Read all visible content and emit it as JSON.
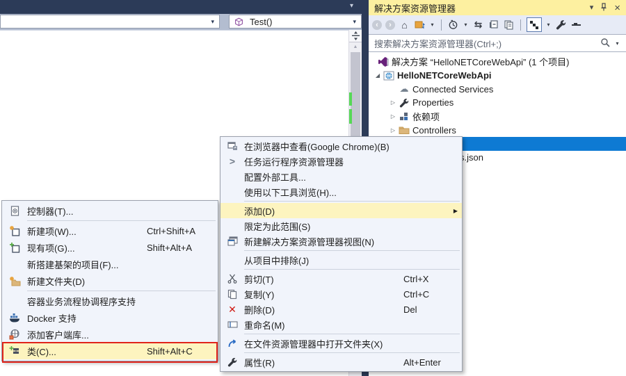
{
  "icons": {
    "dropdown": "▾",
    "up_arrow": "▲",
    "back": "‹",
    "forward": "›",
    "home": "⌂",
    "task_runner": ">",
    "refresh": "⇆",
    "cloud": "☁",
    "close": "×",
    "submenu_arrow": "▶",
    "expander_collapsed": "▷",
    "expander_expanded": "◢",
    "delete_x": "✕"
  },
  "colors": {
    "accent_selection": "#0e7ad3",
    "menu_highlight": "#fdf4bf",
    "tool_window_active_title": "#fdf0a0",
    "attention_border_red": "#e0241b",
    "top_bar_navy": "#2c3b58",
    "change_indicator_green": "#57d957"
  },
  "editor": {
    "type_dropdown_value": "",
    "member_dropdown_value": "Test()"
  },
  "solution_explorer": {
    "title": "解决方案资源管理器",
    "window_buttons": [
      "window-position",
      "pin",
      "close"
    ],
    "toolbar_icons": [
      "back",
      "forward",
      "home",
      "switch-views",
      "pending-changes-filter",
      "refresh",
      "collapse-all",
      "preview-selected-items",
      "sync-with-active-document",
      "properties",
      "collapse"
    ],
    "search_placeholder": "搜索解决方案资源管理器(Ctrl+;)",
    "tree": {
      "solution_label": "解决方案 “HelloNETCoreWebApi” (1 个项目)",
      "project_label": "HelloNETCoreWebApi",
      "items": [
        "Connected Services",
        "Properties",
        "依赖项",
        "Controllers"
      ],
      "selected_row_label": "",
      "partial_file_label": "s.json"
    }
  },
  "context_menu": {
    "items": [
      {
        "label": "在浏览器中查看(Google Chrome)(B)",
        "shortcut": ""
      },
      {
        "label": "任务运行程序资源管理器",
        "shortcut": ""
      },
      {
        "label": "配置外部工具...",
        "shortcut": ""
      },
      {
        "label": "使用以下工具浏览(H)...",
        "shortcut": ""
      },
      {
        "label": "添加(D)",
        "shortcut": "",
        "highlighted": true,
        "has_submenu": true
      },
      {
        "label": "限定为此范围(S)",
        "shortcut": ""
      },
      {
        "label": "新建解决方案资源管理器视图(N)",
        "shortcut": ""
      },
      {
        "label": "从项目中排除(J)",
        "shortcut": ""
      },
      {
        "label": "剪切(T)",
        "shortcut": "Ctrl+X"
      },
      {
        "label": "复制(Y)",
        "shortcut": "Ctrl+C"
      },
      {
        "label": "删除(D)",
        "shortcut": "Del"
      },
      {
        "label": "重命名(M)",
        "shortcut": ""
      },
      {
        "label": "在文件资源管理器中打开文件夹(X)",
        "shortcut": ""
      },
      {
        "label": "属性(R)",
        "shortcut": "Alt+Enter"
      }
    ]
  },
  "add_submenu": {
    "items": [
      {
        "label": "控制器(T)...",
        "shortcut": ""
      },
      {
        "label": "新建项(W)...",
        "shortcut": "Ctrl+Shift+A"
      },
      {
        "label": "现有项(G)...",
        "shortcut": "Shift+Alt+A"
      },
      {
        "label": "新搭建基架的项目(F)...",
        "shortcut": ""
      },
      {
        "label": "新建文件夹(D)",
        "shortcut": ""
      },
      {
        "label": "容器业务流程协调程序支持",
        "shortcut": ""
      },
      {
        "label": "Docker 支持",
        "shortcut": ""
      },
      {
        "label": "添加客户端库...",
        "shortcut": ""
      },
      {
        "label": "类(C)...",
        "shortcut": "Shift+Alt+C",
        "highlighted": true,
        "red_outline": true
      }
    ]
  }
}
